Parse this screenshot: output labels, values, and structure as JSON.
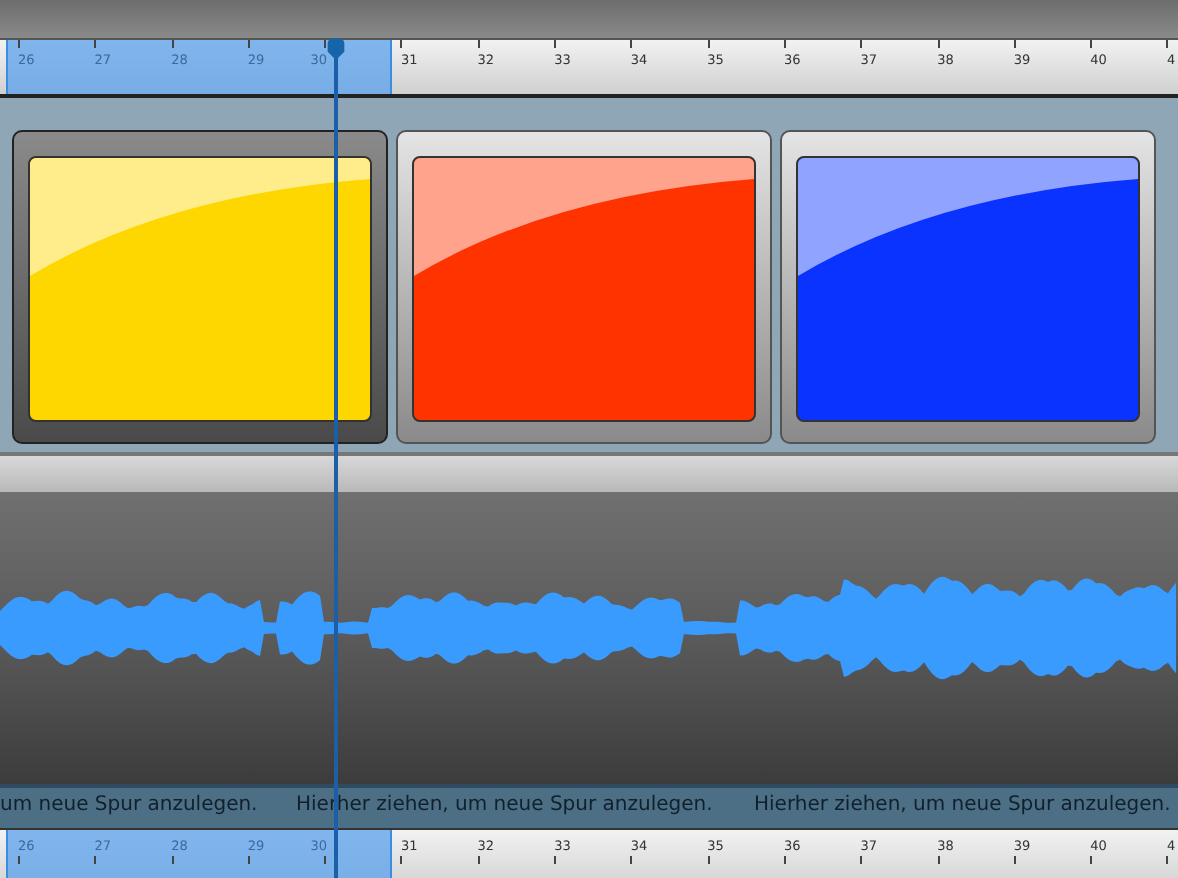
{
  "top_ruler": {
    "labels": [
      "26",
      "27",
      "28",
      "29",
      "30",
      "31",
      "32",
      "33",
      "34",
      "35",
      "36",
      "37",
      "38",
      "39",
      "40",
      "4"
    ]
  },
  "clips": [
    {
      "color": "#ffd700",
      "selected": true
    },
    {
      "color": "#ff3300",
      "selected": false
    },
    {
      "color": "#0a33ff",
      "selected": false
    }
  ],
  "audio_track": {
    "kind": "waveform"
  },
  "drop_hints": [
    "um neue Spur anzulegen.",
    "Hierher ziehen, um neue Spur anzulegen.",
    "Hierher ziehen, um neue Spur anzulegen."
  ],
  "bottom_ruler": {
    "labels": [
      "26",
      "27",
      "28",
      "29",
      "30",
      "31",
      "32",
      "33",
      "34",
      "35",
      "36",
      "37",
      "38",
      "39",
      "40",
      "4"
    ]
  }
}
